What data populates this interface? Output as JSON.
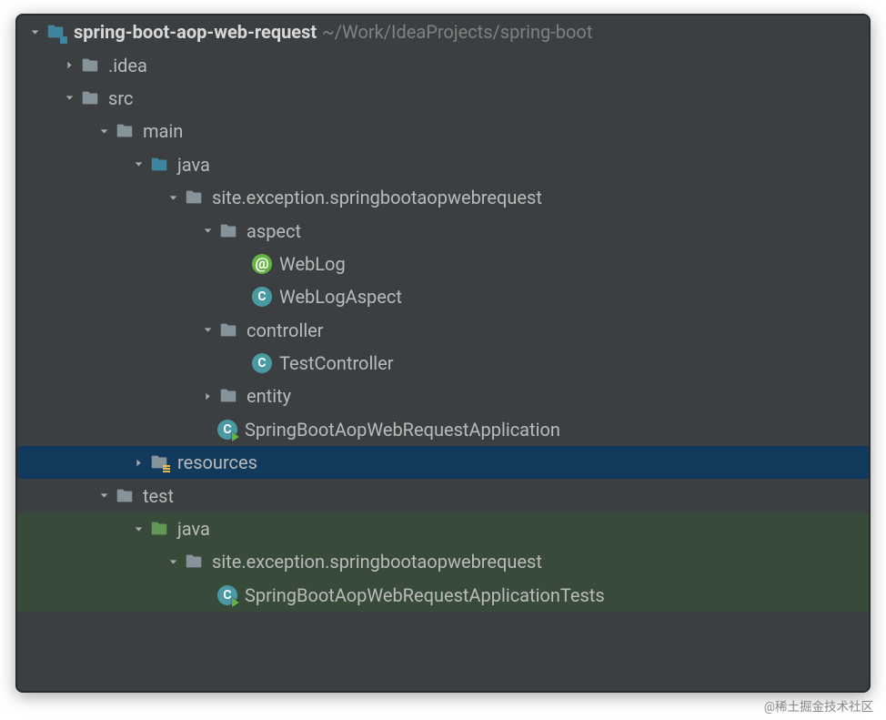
{
  "watermark": "@稀土掘金技术社区",
  "tree": [
    {
      "indent": 0,
      "arrow": "down",
      "icon": "module",
      "label": "spring-boot-aop-web-request",
      "bold": true,
      "suffix": "~/Work/IdeaProjects/spring-boot",
      "name": "root-project"
    },
    {
      "indent": 1,
      "arrow": "right",
      "icon": "folder-grey",
      "label": ".idea",
      "name": "folder-idea"
    },
    {
      "indent": 1,
      "arrow": "down",
      "icon": "folder-grey",
      "label": "src",
      "name": "folder-src"
    },
    {
      "indent": 2,
      "arrow": "down",
      "icon": "folder-grey",
      "label": "main",
      "name": "folder-main"
    },
    {
      "indent": 3,
      "arrow": "down",
      "icon": "folder-blue",
      "label": "java",
      "name": "folder-java-main"
    },
    {
      "indent": 4,
      "arrow": "down",
      "icon": "folder-grey",
      "label": "site.exception.springbootaopwebrequest",
      "name": "package-main"
    },
    {
      "indent": 5,
      "arrow": "down",
      "icon": "folder-grey",
      "label": "aspect",
      "name": "folder-aspect"
    },
    {
      "indent": 6,
      "arrow": "none",
      "icon": "annotation",
      "label": "WebLog",
      "name": "class-weblog"
    },
    {
      "indent": 6,
      "arrow": "none",
      "icon": "class",
      "label": "WebLogAspect",
      "name": "class-weblogaspect"
    },
    {
      "indent": 5,
      "arrow": "down",
      "icon": "folder-grey",
      "label": "controller",
      "name": "folder-controller"
    },
    {
      "indent": 6,
      "arrow": "none",
      "icon": "class",
      "label": "TestController",
      "name": "class-testcontroller"
    },
    {
      "indent": 5,
      "arrow": "right",
      "icon": "folder-grey",
      "label": "entity",
      "name": "folder-entity"
    },
    {
      "indent": 5,
      "arrow": "none",
      "icon": "class-run",
      "label": "SpringBootAopWebRequestApplication",
      "name": "class-application"
    },
    {
      "indent": 3,
      "arrow": "right",
      "icon": "resources",
      "label": "resources",
      "selected": true,
      "name": "folder-resources"
    },
    {
      "indent": 2,
      "arrow": "down",
      "icon": "folder-grey",
      "label": "test",
      "name": "folder-test"
    },
    {
      "indent": 3,
      "arrow": "down",
      "icon": "folder-green",
      "label": "java",
      "green": true,
      "name": "folder-java-test"
    },
    {
      "indent": 4,
      "arrow": "down",
      "icon": "folder-grey",
      "label": "site.exception.springbootaopwebrequest",
      "green": true,
      "name": "package-test"
    },
    {
      "indent": 5,
      "arrow": "none",
      "icon": "class-run",
      "label": "SpringBootAopWebRequestApplicationTests",
      "green": true,
      "name": "class-applicationtests"
    }
  ]
}
